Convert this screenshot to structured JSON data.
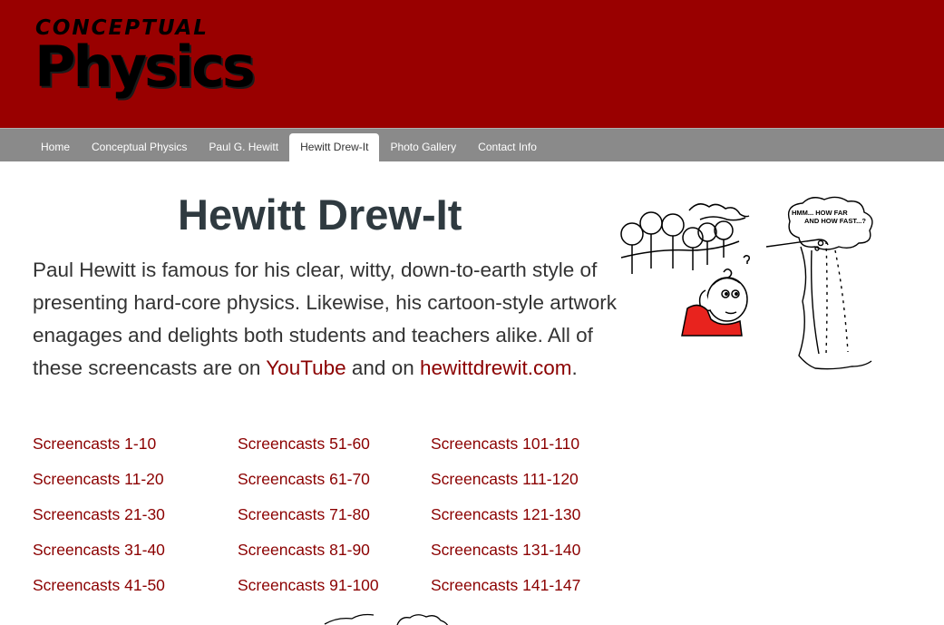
{
  "logo": {
    "top": "CONCEPTUAL",
    "main": "Physics"
  },
  "nav": {
    "items": [
      "Home",
      "Conceptual Physics",
      "Paul G. Hewitt",
      "Hewitt Drew-It",
      "Photo Gallery",
      "Contact Info"
    ],
    "active": "Hewitt Drew-It"
  },
  "page": {
    "title": "Hewitt Drew-It",
    "intro_text": "Paul Hewitt is famous for his clear, witty, down-to-earth style of presenting hard-core physics. Likewise, his cartoon-style artwork enagages and delights both students and teachers alike. All of these screencasts are on ",
    "youtube_link": "YouTube",
    "intro_mid": " and on ",
    "site_link": "hewittdrewit.com",
    "intro_end": "."
  },
  "screencasts": {
    "col1": [
      "Screencasts 1-10",
      "Screencasts 11-20",
      "Screencasts 21-30",
      "Screencasts 31-40",
      "Screencasts 41-50"
    ],
    "col2": [
      "Screencasts 51-60",
      "Screencasts 61-70",
      "Screencasts 71-80",
      "Screencasts 81-90",
      "Screencasts 91-100"
    ],
    "col3": [
      "Screencasts 101-110",
      "Screencasts 111-120",
      "Screencasts 121-130",
      "Screencasts 131-140",
      "Screencasts 141-147"
    ]
  },
  "cartoon": {
    "thought_bubble": "HMM... HOW FAR AND HOW FAST...?"
  },
  "colors": {
    "header_bg": "#990000",
    "nav_bg": "#8a8a8a",
    "link": "#8b0000",
    "text": "#333333"
  }
}
